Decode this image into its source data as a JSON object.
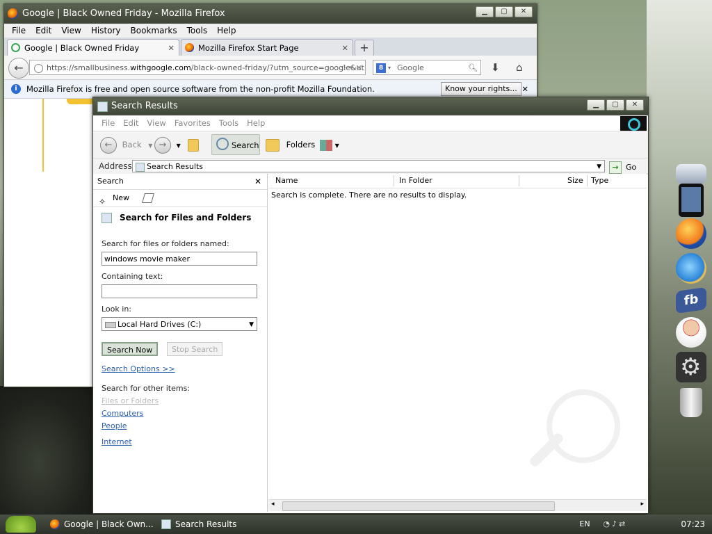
{
  "firefox": {
    "title": "Google | Black Owned Friday - Mozilla Firefox",
    "menu": [
      "File",
      "Edit",
      "View",
      "History",
      "Bookmarks",
      "Tools",
      "Help"
    ],
    "tabs": [
      {
        "label": "Google | Black Owned Friday"
      },
      {
        "label": "Mozilla Firefox Start Page"
      }
    ],
    "url_prefix": "https://smallbusiness.",
    "url_domain": "withgoogle.com",
    "url_rest": "/black-owned-friday/?utm_source=google&ut",
    "search_placeholder": "Google",
    "info_text": "Mozilla Firefox is free and open source software from the non-profit Mozilla Foundation.",
    "know_rights": "Know your rights..."
  },
  "search_window": {
    "title": "Search Results",
    "menu": [
      "File",
      "Edit",
      "View",
      "Favorites",
      "Tools",
      "Help"
    ],
    "toolbar": {
      "back": "Back",
      "search": "Search",
      "folders": "Folders"
    },
    "address_label": "Address",
    "address_value": "Search Results",
    "go_label": "Go",
    "pane": {
      "header": "Search",
      "new_label": "New",
      "section_title": "Search for Files and Folders",
      "named_label": "Search for files or folders named:",
      "named_value": "windows movie maker",
      "containing_label": "Containing text:",
      "containing_value": "",
      "lookin_label": "Look in:",
      "lookin_value": "Local Hard Drives (C:)",
      "search_now": "Search Now",
      "stop_search": "Stop Search",
      "search_options": "Search Options >>",
      "other_items_label": "Search for other items:",
      "other_items": [
        "Files or Folders",
        "Computers",
        "People"
      ],
      "internet": "Internet"
    },
    "columns": [
      "Name",
      "In Folder",
      "Size",
      "Type"
    ],
    "message": "Search is complete. There are no results to display."
  },
  "taskbar": {
    "tasks": [
      "Google | Black Own...",
      "Search Results"
    ],
    "lang": "EN",
    "clock": "07:23"
  },
  "colors": {
    "link": "#2a5fae",
    "titlebar": "#4a5144",
    "accent": "#f2c230"
  }
}
